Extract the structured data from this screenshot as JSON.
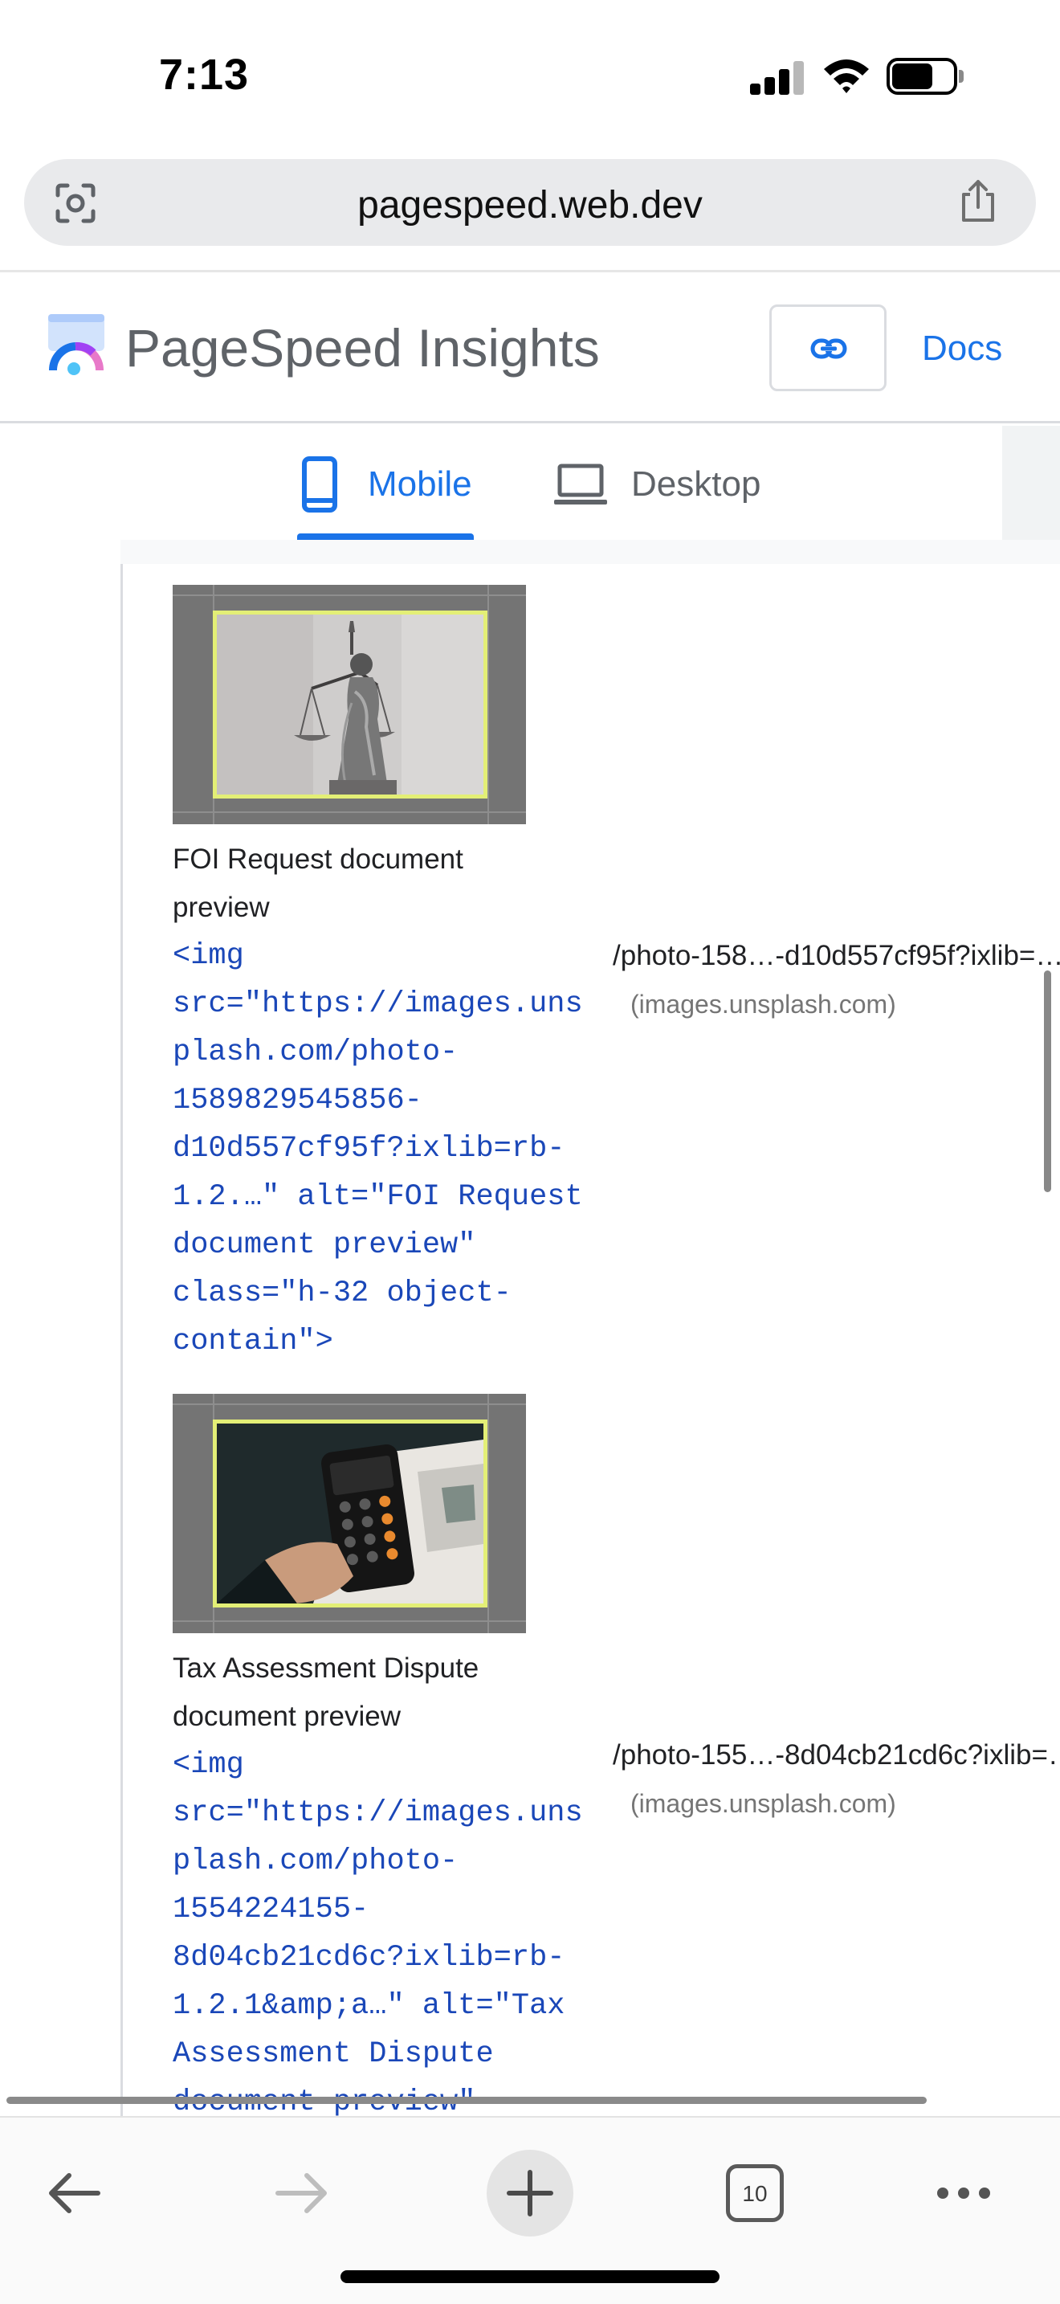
{
  "status_bar": {
    "time": "7:13",
    "icons": [
      "signal-icon",
      "wifi-icon",
      "battery-icon"
    ]
  },
  "browser": {
    "url": "pagespeed.web.dev",
    "icons": [
      "lens-icon",
      "share-icon"
    ]
  },
  "header": {
    "title": "PageSpeed Insights",
    "docs_label": "Docs",
    "icons": [
      "psi-logo-icon",
      "link-icon"
    ]
  },
  "tabs": [
    {
      "label": "Mobile",
      "selected": true,
      "icon": "mobile-icon"
    },
    {
      "label": "Desktop",
      "selected": false,
      "icon": "desktop-icon"
    }
  ],
  "items": [
    {
      "label": "FOI Request document\npreview",
      "snippet": "<img\nsrc=\"https://images.uns\nplash.com/photo-\n1589829545856-\nd10d557cf95f?ixlib=rb-\n1.2.…\" alt=\"FOI Request\ndocument preview\"\nclass=\"h-32 object-\ncontain\">",
      "url": "/photo-158…-d10d557cf95f?ixlib=…",
      "host": "(images.unsplash.com)"
    },
    {
      "label": "Tax Assessment Dispute\ndocument preview",
      "snippet": "<img\nsrc=\"https://images.uns\nplash.com/photo-\n1554224155-\n8d04cb21cd6c?ixlib=rb-\n1.2.1&amp;a…\" alt=\"Tax\nAssessment Dispute\ndocument preview\"",
      "url": "/photo-155…-8d04cb21cd6c?ixlib=…",
      "host": "(images.unsplash.com)"
    }
  ],
  "bottom_bar": {
    "tabs_count": "10",
    "icons": [
      "back-arrow-icon",
      "forward-arrow-icon",
      "plus-icon",
      "tabs-icon",
      "more-icon"
    ]
  },
  "colors": {
    "accent": "#1a73e8",
    "code": "#1a47b8",
    "highlight_border": "#e3ef76"
  }
}
